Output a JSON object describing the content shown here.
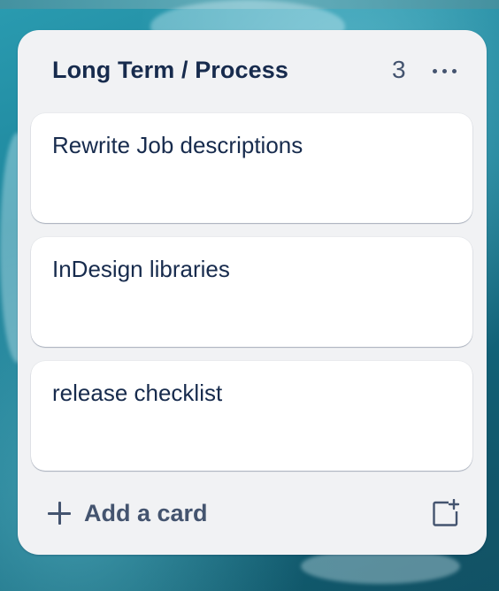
{
  "list": {
    "title": "Long Term / Process",
    "count": "3",
    "menu_icon": "more-horizontal-icon",
    "cards": [
      {
        "title": "Rewrite Job descriptions"
      },
      {
        "title": "InDesign libraries"
      },
      {
        "title": "release checklist"
      }
    ],
    "add_card_label": "Add a card",
    "add_icon": "plus-icon",
    "template_icon": "create-from-template-icon"
  },
  "colors": {
    "list_bg": "#f1f2f4",
    "card_bg": "#ffffff",
    "text_primary": "#172b4d",
    "text_secondary": "#44546f"
  }
}
